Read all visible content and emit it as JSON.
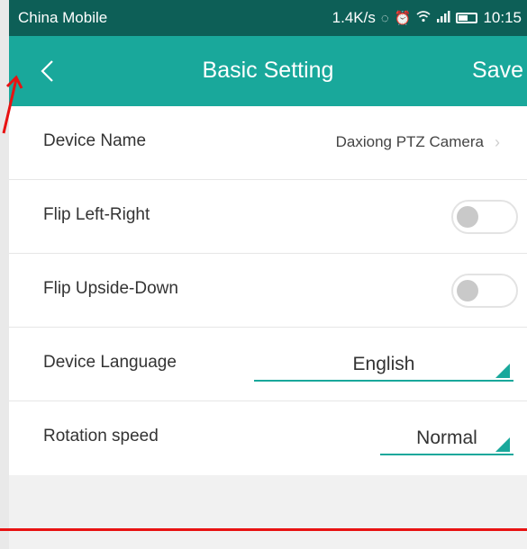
{
  "status_bar": {
    "carrier": "China Mobile",
    "speed": "1.4K/s",
    "time": "10:15"
  },
  "header": {
    "title": "Basic Setting",
    "save_label": "Save"
  },
  "settings": {
    "device_name": {
      "label": "Device Name",
      "value": "Daxiong PTZ Camera"
    },
    "flip_lr": {
      "label": "Flip Left-Right",
      "on": false
    },
    "flip_ud": {
      "label": "Flip Upside-Down",
      "on": false
    },
    "language": {
      "label": "Device Language",
      "value": "English"
    },
    "rotation": {
      "label": "Rotation speed",
      "value": "Normal"
    }
  },
  "colors": {
    "accent": "#19a89b",
    "status_bar": "#0d5f57",
    "annotation_red": "#e81212"
  },
  "icons": {
    "back": "chevron-left-icon",
    "row_arrow": "chevron-right-icon",
    "dropdown": "dropdown-corner-icon"
  }
}
